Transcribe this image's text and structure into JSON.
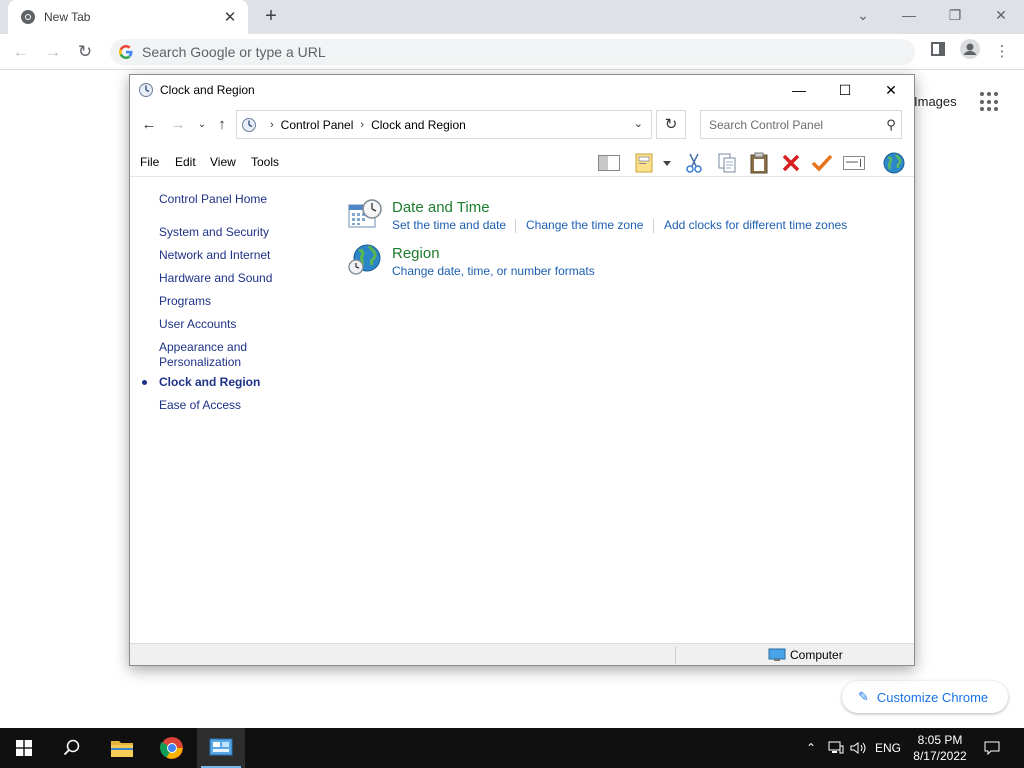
{
  "chrome": {
    "tab_title": "New Tab",
    "tab_close": "✕",
    "new_tab": "+",
    "omnibox_placeholder": "Search Google or type a URL",
    "ntp_images": "Images",
    "customize_label": "Customize Chrome"
  },
  "window": {
    "title": "Clock and Region",
    "breadcrumbs": [
      "Control Panel",
      "Clock and Region"
    ],
    "search_placeholder": "Search Control Panel",
    "menu": [
      "File",
      "Edit",
      "View",
      "Tools"
    ],
    "sidebar": [
      "Control Panel Home",
      "System and Security",
      "Network and Internet",
      "Hardware and Sound",
      "Programs",
      "User Accounts",
      "Appearance and Personalization",
      "Clock and Region",
      "Ease of Access"
    ],
    "active_sidebar": "Clock and Region",
    "categories": [
      {
        "title": "Date and Time",
        "icon": "date-time-icon",
        "links": [
          "Set the time and date",
          "Change the time zone",
          "Add clocks for different time zones"
        ]
      },
      {
        "title": "Region",
        "icon": "globe-icon",
        "links": [
          "Change date, time, or number formats"
        ]
      }
    ],
    "status_text": "Computer"
  },
  "taskbar": {
    "language": "ENG",
    "time": "8:05 PM",
    "date": "8/17/2022"
  }
}
